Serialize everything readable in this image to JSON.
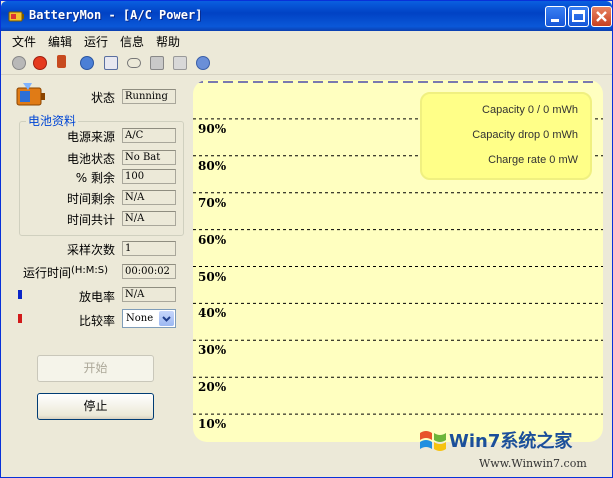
{
  "window": {
    "title": "BatteryMon - [A/C Power]"
  },
  "menu": [
    "文件",
    "编辑",
    "运行",
    "信息",
    "帮助"
  ],
  "toolbar": {
    "icons": [
      "options-icon",
      "stop-icon",
      "battery-icon",
      "info-icon",
      "clipboard-icon",
      "link-icon",
      "tools-icon",
      "wizard-icon",
      "help-icon"
    ]
  },
  "status": {
    "label": "状态",
    "value": "Running"
  },
  "battery_group": {
    "title": "电池资料",
    "fields": [
      {
        "label": "电源来源",
        "value": "A/C"
      },
      {
        "label": "电池状态",
        "value": "No Bat"
      },
      {
        "label": "% 剩余",
        "value": "100"
      },
      {
        "label": "时间剩余",
        "value": "N/A"
      },
      {
        "label": "时间共计",
        "value": "N/A"
      }
    ]
  },
  "sampling": {
    "label": "采样次数",
    "value": "1"
  },
  "runtime": {
    "label": "运行时间",
    "format": "(H:M:S)",
    "value": "00:00:02"
  },
  "discharge": {
    "label": "放电率",
    "value": "N/A",
    "color": "#0a25c8"
  },
  "compare": {
    "label": "比较率",
    "selected": "None",
    "color": "#d21a1a"
  },
  "buttons": {
    "start": "开始",
    "stop": "停止"
  },
  "chart_data": {
    "type": "line",
    "y_ticks": [
      "90%",
      "80%",
      "70%",
      "60%",
      "50%",
      "40%",
      "30%",
      "20%",
      "10%"
    ],
    "series": [
      {
        "values": [
          100
        ],
        "color": "#7a7ab0"
      }
    ],
    "ylim": [
      0,
      100
    ],
    "grid": true,
    "background": "#ffffc0",
    "info": {
      "capacity": "Capacity 0 / 0 mWh",
      "capacity_drop": "Capacity drop 0 mWh",
      "charge_rate": "Charge rate 0 mW"
    }
  },
  "watermark": {
    "text": "Win7系统之家",
    "url": "Www.Winwin7.com"
  },
  "colors": {
    "title_bar": "#0142c4",
    "chart_bg": "#ffffc0",
    "info_panel": "#ffff88",
    "group_title": "#0046d5"
  }
}
